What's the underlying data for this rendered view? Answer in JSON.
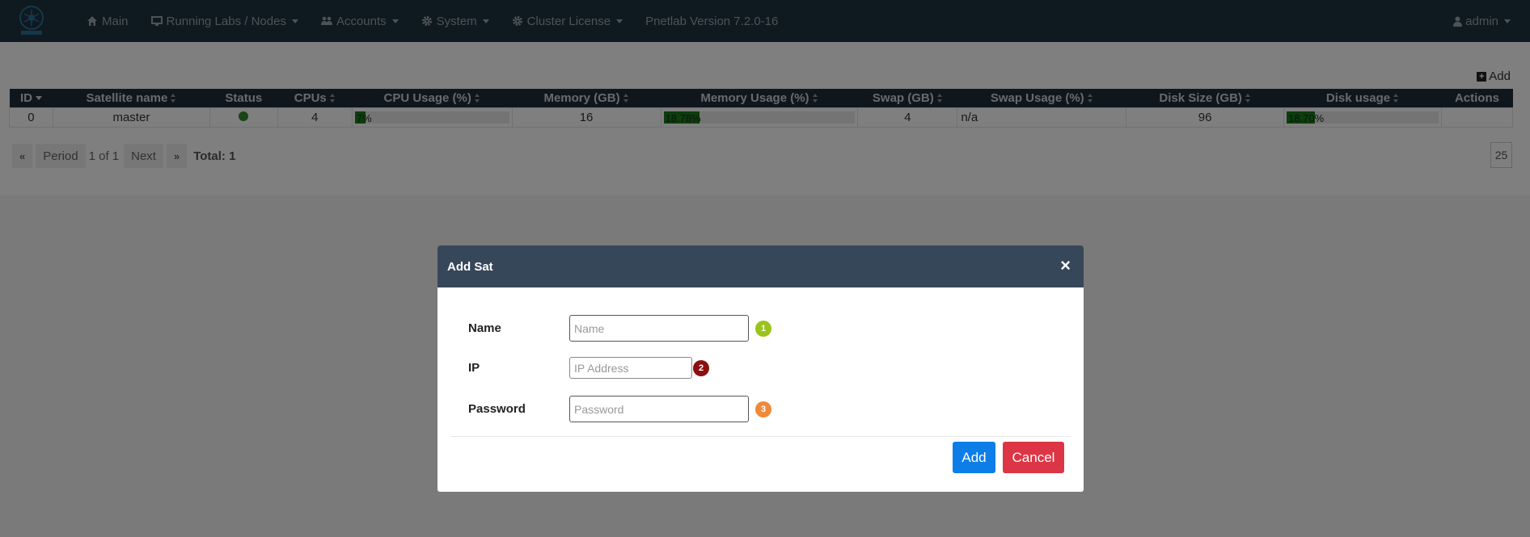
{
  "navbar": {
    "items": [
      {
        "label": "Main",
        "icon": "home-icon",
        "dropdown": false
      },
      {
        "label": "Running Labs / Nodes",
        "icon": "monitor-icon",
        "dropdown": true
      },
      {
        "label": "Accounts",
        "icon": "users-icon",
        "dropdown": true
      },
      {
        "label": "System",
        "icon": "gear-icon",
        "dropdown": true
      },
      {
        "label": "Cluster License",
        "icon": "gear-icon",
        "dropdown": true
      }
    ],
    "version": "Pnetlab Version 7.2.0-16",
    "user": "admin"
  },
  "toolbar": {
    "add_label": "Add"
  },
  "table": {
    "columns": [
      "ID",
      "Satellite name",
      "Status",
      "CPUs",
      "CPU Usage (%)",
      "Memory (GB)",
      "Memory Usage (%)",
      "Swap (GB)",
      "Swap Usage (%)",
      "Disk Size (GB)",
      "Disk usage",
      "Actions"
    ],
    "rows": [
      {
        "id": "0",
        "name": "master",
        "status": "online",
        "cpus": "4",
        "cpu_usage": {
          "text": "7%",
          "value": 7
        },
        "memory": "16",
        "memory_usage": {
          "text": "18.78%",
          "value": 18.78
        },
        "swap": "4",
        "swap_usage": "n/a",
        "disk_size": "96",
        "disk_usage": {
          "text": "18.70%",
          "value": 18.7
        }
      }
    ]
  },
  "pager": {
    "prev_label": "Period",
    "page_info": "1 of 1",
    "next_label": "Next",
    "total": "Total: 1",
    "page_size": "25"
  },
  "modal": {
    "title": "Add Sat",
    "close": "×",
    "fields": {
      "name": {
        "label": "Name",
        "placeholder": "Name",
        "badge": "1",
        "badge_color": "#9ac31c"
      },
      "ip": {
        "label": "IP",
        "placeholder": "IP Address",
        "badge": "2",
        "badge_color": "#8b0f0f"
      },
      "password": {
        "label": "Password",
        "placeholder": "Password",
        "badge": "3",
        "badge_color": "#f0893a"
      }
    },
    "add_label": "Add",
    "cancel_label": "Cancel"
  },
  "colors": {
    "navbar": "#1f3340",
    "add_button": "#0d7ee8",
    "cancel_button": "#dc3545"
  }
}
